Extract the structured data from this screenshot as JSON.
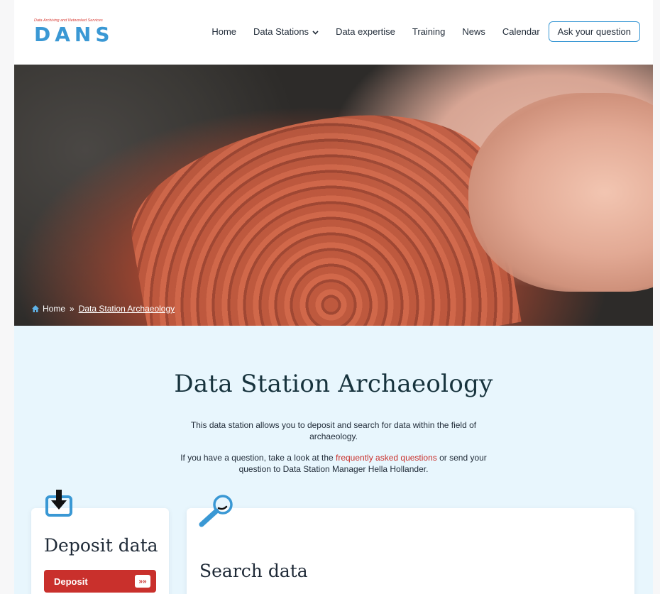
{
  "header": {
    "logo": {
      "tagline": "Data Archiving and Networked Services",
      "word": "DANS"
    },
    "nav": [
      {
        "label": "Home"
      },
      {
        "label": "Data Stations",
        "has_dropdown": true
      },
      {
        "label": "Data expertise"
      },
      {
        "label": "Training"
      },
      {
        "label": "News"
      },
      {
        "label": "Calendar"
      }
    ],
    "cta_label": "Ask your question"
  },
  "breadcrumb": {
    "home": "Home",
    "separator": "»",
    "current": "Data Station Archaeology"
  },
  "main": {
    "title": "Data Station Archaeology",
    "intro_1": "This data station allows you to deposit and search for data within the field of archaeology.",
    "intro_2_before": "If you have a question, take a look at the ",
    "intro_2_link": "frequently asked questions",
    "intro_2_after": " or send your question to Data Station Manager Hella Hollander."
  },
  "cards": {
    "deposit": {
      "title": "Deposit data",
      "button_label": "Deposit",
      "button_arrow": "»»",
      "icon": "download-icon"
    },
    "search": {
      "title": "Search data",
      "icon": "search-icon"
    }
  },
  "colors": {
    "accent_blue": "#3a98d4",
    "accent_red": "#c9302c",
    "content_bg": "#e8f6fd",
    "heading": "#17333d"
  }
}
